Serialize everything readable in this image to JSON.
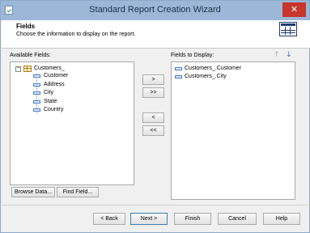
{
  "window": {
    "title": "Standard Report Creation Wizard",
    "close_glyph": "✕"
  },
  "header": {
    "title": "Fields",
    "subtitle": "Choose the information to display on the report."
  },
  "available": {
    "label": "Available Fields:",
    "expander": "−",
    "table_name": "Customers_",
    "fields": [
      "Customer",
      "Address",
      "City",
      "State",
      "Country"
    ]
  },
  "transfer": {
    "add_one": ">",
    "add_all": ">>",
    "remove_one": "<",
    "remove_all": "<<"
  },
  "display": {
    "label": "Fields to Display:",
    "fields": [
      "Customers_.Customer",
      "Customers_.City"
    ],
    "move_up_glyph": "↑",
    "move_down_glyph": "↓"
  },
  "left_buttons": {
    "browse": "Browse Data...",
    "find": "Find Field..."
  },
  "footer": {
    "back": "< Back",
    "next": "Next >",
    "finish": "Finish",
    "cancel": "Cancel",
    "help": "Help"
  }
}
